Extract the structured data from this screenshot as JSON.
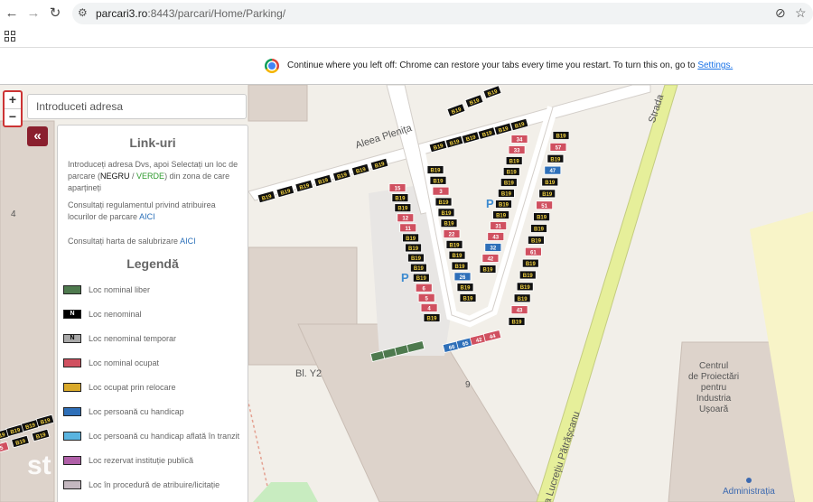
{
  "browser": {
    "url_host": "parcari3.ro",
    "url_path": ":8443/parcari/Home/Parking/"
  },
  "infobar": {
    "message": "Continue where you left off: Chrome can restore your tabs every time you restart. To turn this on, go to",
    "link": "Settings."
  },
  "map": {
    "search_placeholder": "Introduceti adresa",
    "zoom_in": "+",
    "zoom_out": "−",
    "collapse": "«",
    "labels": {
      "street_plenita": "Aleea Plenița",
      "street_strada": "Strada",
      "street_patrascanu": "a Lucrețiu Pătrășcanu",
      "block_y2": "Bl. Y2",
      "number_9": "9",
      "number_4": "4",
      "centrul": "Centrul\nde Proiectări\npentru\nIndustria\nUșoară",
      "administratia": "Administrația",
      "watermark": "st"
    },
    "spot_code": "B19"
  },
  "panel": {
    "links_title": "Link-uri",
    "intro": {
      "before": "Introduceți adresa Dvs, apoi Selectați un loc de parcare (",
      "negru": "NEGRU",
      "slash": " / ",
      "verde": "VERDE",
      "after": ") din zona de care aparțineți"
    },
    "regulament": "Consultați regulamentul privind atribuirea locurilor de parcare",
    "regulament_link": "AICI",
    "harta": "Consultați harta de salubrizare",
    "harta_link": "AICI",
    "legend_title": "Legendă",
    "legend": [
      {
        "label": "Loc nominal liber",
        "color": "#4e7a4e",
        "mark": ""
      },
      {
        "label": "Loc nenominal",
        "color": "#000000",
        "mark": "N"
      },
      {
        "label": "Loc nenominal temporar",
        "color": "#a8a8a8",
        "mark": "N"
      },
      {
        "label": "Loc nominal ocupat",
        "color": "#d05060",
        "mark": ""
      },
      {
        "label": "Loc ocupat prin relocare",
        "color": "#d9a92a",
        "mark": ""
      },
      {
        "label": "Loc persoană cu handicap",
        "color": "#2e6fb8",
        "mark": ""
      },
      {
        "label": "Loc persoană cu handicap aflată în tranzit",
        "color": "#5ab4e0",
        "mark": ""
      },
      {
        "label": "Loc rezervat instituție publică",
        "color": "#b060a8",
        "mark": ""
      },
      {
        "label": "Loc în procedură de atribuire/licitație",
        "color": "#c4b8c0",
        "mark": ""
      }
    ]
  },
  "colors": {
    "accent": "#8a1f2e",
    "link": "#1a73e8",
    "verde": "#2e9a2e",
    "spot_black": "#111111",
    "spot_red": "#d05060",
    "spot_blue": "#2e6fb8",
    "spot_green": "#4e7a4e",
    "road_yellow": "#e6ef9a"
  },
  "spots": {
    "red_numbers": [
      "15",
      "12",
      "11",
      "6",
      "5",
      "4",
      "3",
      "22",
      "34",
      "33",
      "31",
      "43",
      "42",
      "57",
      "51",
      "61",
      "43",
      "42",
      "44"
    ],
    "blue_numbers": [
      "26",
      "32",
      "47",
      "66",
      "65"
    ]
  }
}
